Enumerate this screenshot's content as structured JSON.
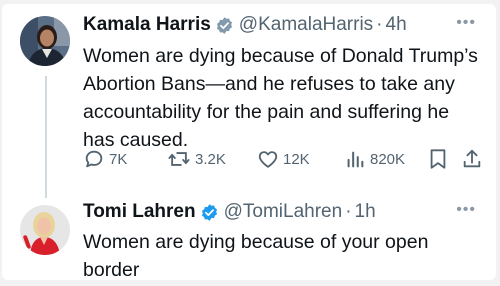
{
  "tweet1": {
    "name": "Kamala Harris",
    "handle": "@KamalaHarris",
    "separator": "·",
    "time": "4h",
    "text": "Women are dying because of Donald Trump’s\nAbortion Bans—and he refuses to take any\naccountability for the pain and suffering he\nhas caused.",
    "more_icon": "more-dots-icon",
    "metrics": {
      "replies": "7K",
      "reposts": "3.2K",
      "likes": "12K",
      "views": "820K"
    }
  },
  "tweet2": {
    "name": "Tomi Lahren",
    "handle": "@TomiLahren",
    "separator": "·",
    "time": "1h",
    "text": "Women are dying because of your open\nborder",
    "more_icon": "more-dots-icon"
  },
  "colors": {
    "verified_badge": "#1d9bf0",
    "muted_text": "#536471",
    "thread_line": "#cfd9de"
  }
}
